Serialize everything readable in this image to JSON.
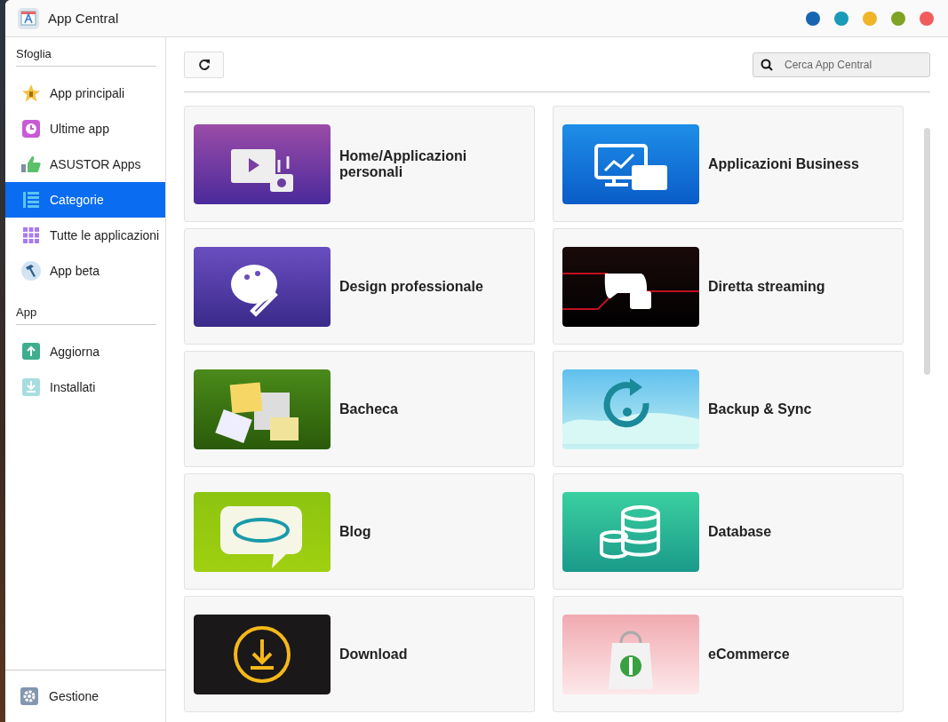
{
  "window": {
    "title": "App Central",
    "dots": [
      {
        "color": "#1565b0"
      },
      {
        "color": "#1a9bb8"
      },
      {
        "color": "#f0b429"
      },
      {
        "color": "#7fa324"
      },
      {
        "color": "#f25c5c"
      }
    ]
  },
  "sidebar": {
    "sections": [
      {
        "label": "Sfoglia",
        "items": [
          {
            "label": "App principali",
            "selected": false
          },
          {
            "label": "Ultime app",
            "selected": false
          },
          {
            "label": "ASUSTOR Apps",
            "selected": false
          },
          {
            "label": "Categorie",
            "selected": true
          },
          {
            "label": "Tutte le applicazioni",
            "selected": false
          },
          {
            "label": "App beta",
            "selected": false
          }
        ]
      },
      {
        "label": "App",
        "items": [
          {
            "label": "Aggiorna",
            "selected": false
          },
          {
            "label": "Installati",
            "selected": false
          }
        ]
      }
    ],
    "footer": {
      "label": "Gestione"
    }
  },
  "search": {
    "placeholder": "Cerca App Central"
  },
  "categories": [
    {
      "title": "Home/Applicazioni personali"
    },
    {
      "title": "Applicazioni Business"
    },
    {
      "title": "Design professionale"
    },
    {
      "title": "Diretta streaming"
    },
    {
      "title": "Bacheca"
    },
    {
      "title": "Backup & Sync"
    },
    {
      "title": "Blog"
    },
    {
      "title": "Database"
    },
    {
      "title": "Download"
    },
    {
      "title": "eCommerce"
    }
  ]
}
